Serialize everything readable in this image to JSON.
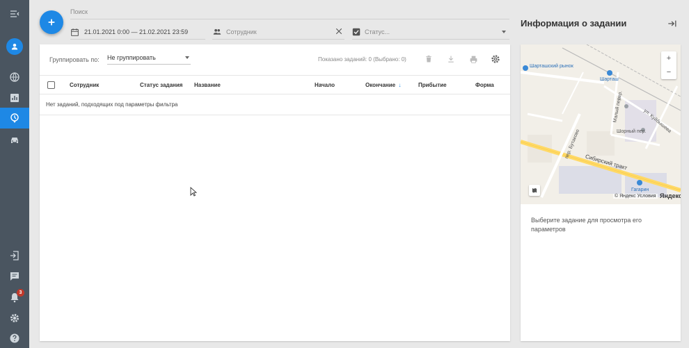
{
  "search": {
    "label": "Поиск"
  },
  "filters": {
    "date_range": "21.01.2021 0:00 — 21.02.2021 23:59",
    "employee_placeholder": "Сотрудник",
    "status_placeholder": "Статус..."
  },
  "toolbar": {
    "group_label": "Группировать по:",
    "group_value": "Не группировать",
    "shown_text": "Показано заданий: 0 (Выбрано: 0)"
  },
  "table": {
    "columns": [
      "Сотрудник",
      "Статус задания",
      "Название",
      "Начало",
      "Окончание",
      "Прибытие",
      "Форма"
    ],
    "sort_indicator": "↓",
    "empty_text": "Нет заданий, подходящих под параметры фильтра"
  },
  "info": {
    "title": "Информация о задании",
    "hint": "Выберите задание для просмотра его параметров",
    "map": {
      "zoom_in": "+",
      "zoom_out": "−",
      "copyright": "© Яндекс Условия",
      "brand": "Яндекс",
      "labels": {
        "market": "Шарташский рынок",
        "station": "Шарташ",
        "tract": "Сибирский тракт",
        "gagarin": "Гагарин",
        "kuybysheva": "ул. Куйбышева",
        "bulgakov": "пер. Бутаково",
        "sh_per": "Шорный пер.",
        "mes_per": "Малый пер.",
        "bum_per": "пер."
      }
    }
  },
  "rail": {
    "notifications_count": "3"
  },
  "colors": {
    "accent": "#1e88e5",
    "rail": "#4a5560",
    "badge": "#c0392b"
  }
}
